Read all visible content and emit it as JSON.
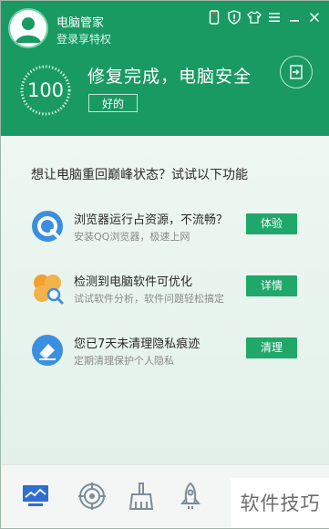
{
  "header": {
    "app_title": "电脑管家",
    "login_link": "登录享特权",
    "score": "100",
    "headline": "修复完成，电脑安全",
    "ok_button": "好的"
  },
  "main": {
    "prompt": "想让电脑重回巅峰状态？试试以下功能",
    "features": [
      {
        "title": "浏览器运行占资源，不流畅？",
        "subtitle": "安装QQ浏览器，极速上网",
        "button": "体验",
        "icon": "qq-browser-icon"
      },
      {
        "title": "检测到电脑软件可优化",
        "subtitle": "试试软件分析，软件问题轻松搞定",
        "button": "详情",
        "icon": "software-analysis-icon"
      },
      {
        "title": "您已7天未清理隐私痕迹",
        "subtitle": "定期清理保护个人隐私",
        "button": "清理",
        "icon": "privacy-eraser-icon"
      }
    ]
  },
  "watermark": "软件技巧",
  "colors": {
    "brand": "#1a9a63",
    "button": "#1fa86a",
    "accent_blue": "#3b8fe0",
    "accent_orange": "#f0a030"
  }
}
